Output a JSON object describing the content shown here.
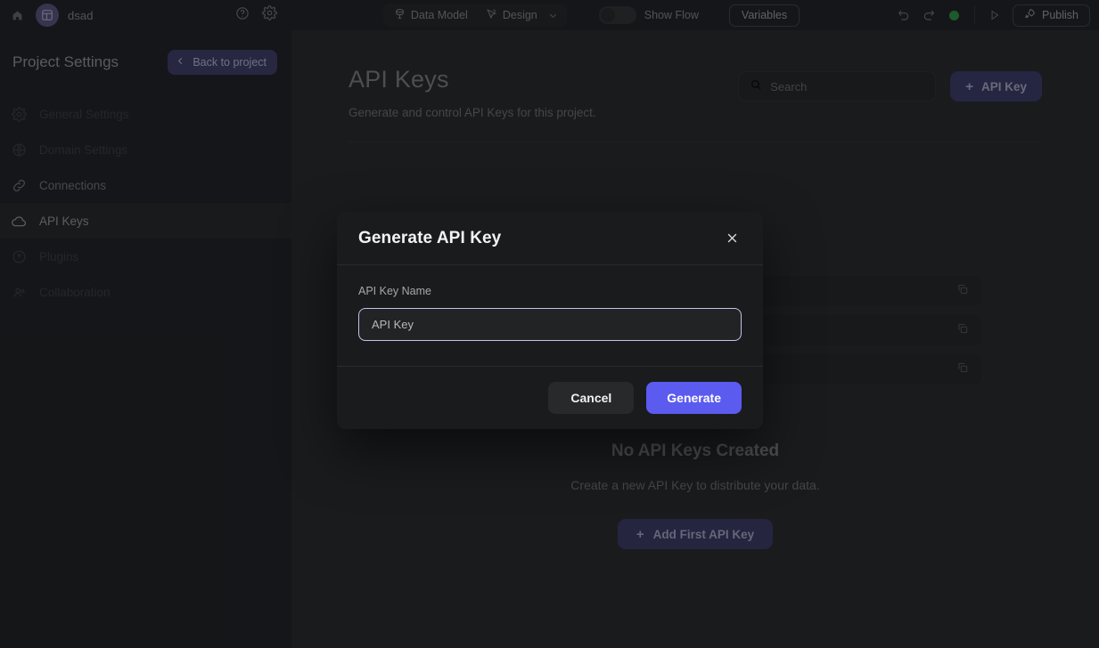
{
  "topbar": {
    "home_icon": "home-icon",
    "avatar_icon": "grid-table-icon",
    "project_name": "dsad",
    "help_icon": "question-circle-icon",
    "settings_icon": "gear-icon",
    "data_model_label": "Data Model",
    "data_model_icon": "database-icon",
    "design_label": "Design",
    "design_icon": "cursor-design-icon",
    "caret_icon": "chevron-down-icon",
    "show_flow_label": "Show Flow",
    "show_flow_state": "off",
    "variables_label": "Variables",
    "undo_icon": "undo-icon",
    "redo_icon": "redo-icon",
    "status_dot_color": "#2f9e44",
    "play_icon": "play-icon",
    "publish_label": "Publish",
    "publish_icon": "rocket-icon"
  },
  "sidebar": {
    "title": "Project Settings",
    "back_label": "Back to project",
    "back_icon": "chevron-left-icon",
    "items": [
      {
        "label": "General Settings",
        "icon": "gear-icon",
        "state": "dim"
      },
      {
        "label": "Domain Settings",
        "icon": "globe-icon",
        "state": "dim"
      },
      {
        "label": "Connections",
        "icon": "link-icon",
        "state": "mid"
      },
      {
        "label": "API Keys",
        "icon": "cloud-icon",
        "state": "active"
      },
      {
        "label": "Plugins",
        "icon": "plug-icon",
        "state": "dim"
      },
      {
        "label": "Collaboration",
        "icon": "people-icon",
        "state": "dim"
      }
    ]
  },
  "main": {
    "title": "API Keys",
    "subtitle": "Generate and control API Keys for this project.",
    "search_placeholder": "Search",
    "search_icon": "search-icon",
    "add_key_label": "API Key",
    "add_key_icon": "plus-icon",
    "background_rows": [
      {
        "copy_icon": "copy-icon"
      },
      {
        "copy_icon": "copy-icon"
      },
      {
        "copy_icon": "copy-icon"
      }
    ],
    "empty_title": "No API Keys Created",
    "empty_desc": "Create a new API Key to distribute your data.",
    "empty_button_label": "Add First API Key",
    "empty_button_icon": "plus-icon"
  },
  "modal": {
    "title": "Generate API Key",
    "close_icon": "close-icon",
    "field_label": "API Key Name",
    "field_value": "API Key",
    "cancel_label": "Cancel",
    "generate_label": "Generate"
  },
  "colors": {
    "accent": "#5b5bf0",
    "accent_muted": "#3c3d6e",
    "background": "#27292b",
    "panel": "#1f2123",
    "modal": "#1a1b1d",
    "status_green": "#2f9e44",
    "focus_ring": "#c4c2ec"
  }
}
